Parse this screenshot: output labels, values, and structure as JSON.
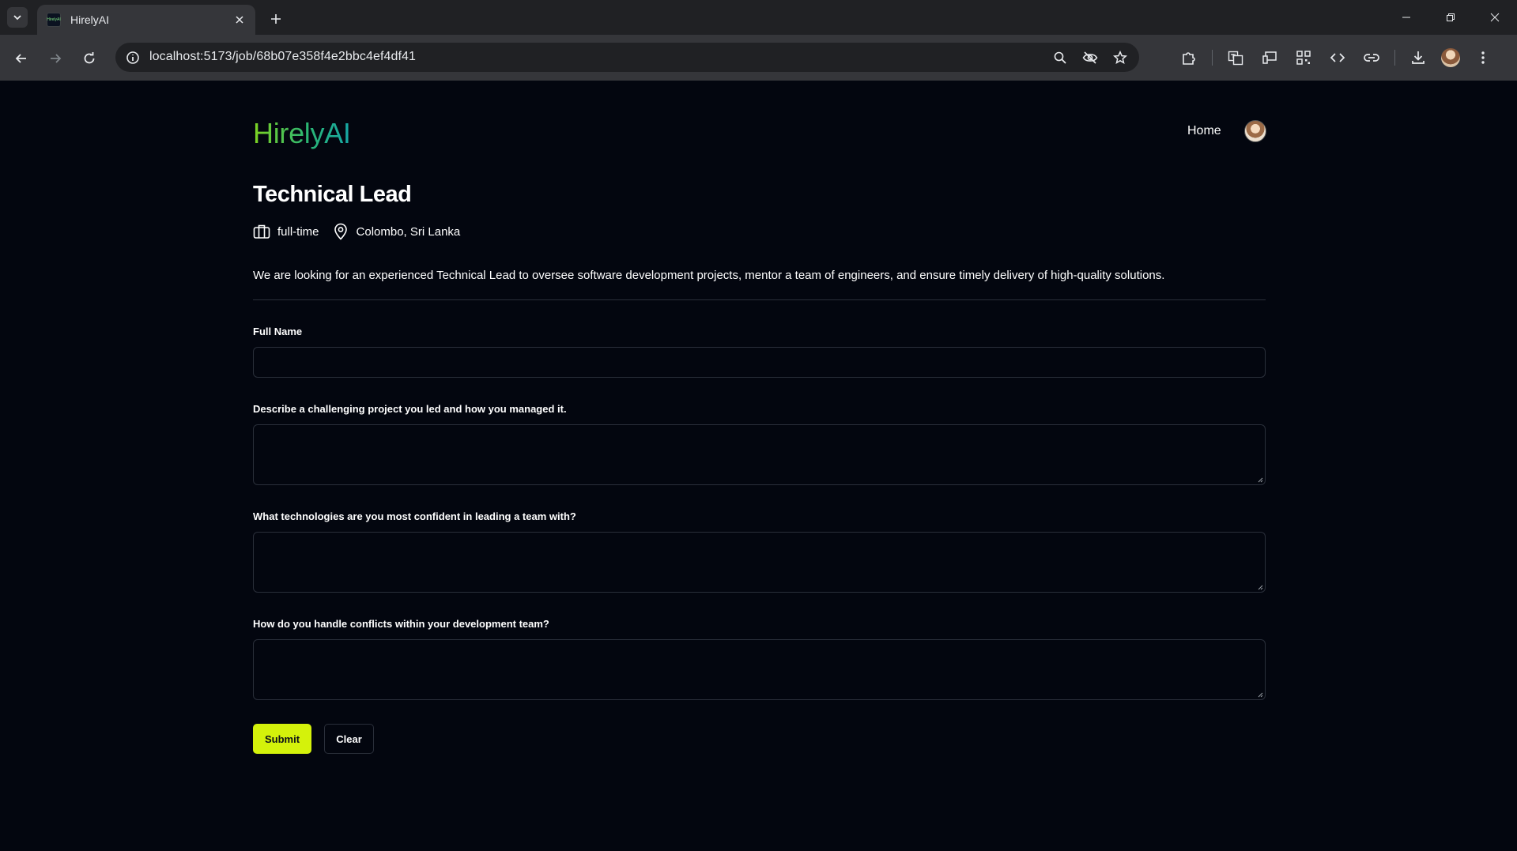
{
  "browser": {
    "tab": {
      "title": "HirelyAI",
      "favicon_text": "HirelyAI"
    },
    "url": "localhost:5173/job/68b07e358f4e2bbc4ef4df41",
    "icons": {
      "tab_list": "chevron-down-icon",
      "tab_close": "close-icon",
      "new_tab": "plus-icon",
      "back": "back-arrow-icon",
      "forward": "forward-arrow-icon",
      "reload": "reload-icon",
      "site_info": "info-icon",
      "zoom": "zoom-icon",
      "tracking": "eye-off-icon",
      "bookmark": "star-icon",
      "extensions": "puzzle-icon",
      "translate": "translate-icon",
      "cast": "cast-icon",
      "qr": "qr-code-icon",
      "devtools": "code-icon",
      "link": "link-icon",
      "download": "download-icon",
      "menu": "kebab-menu-icon"
    }
  },
  "header": {
    "logo": "HirelyAI",
    "nav_home": "Home"
  },
  "job": {
    "title": "Technical Lead",
    "type": "full-time",
    "location": "Colombo, Sri Lanka",
    "description": "We are looking for an experienced Technical Lead to oversee software development projects, mentor a team of engineers, and ensure timely delivery of high-quality solutions."
  },
  "form": {
    "full_name_label": "Full Name",
    "full_name_value": "",
    "questions": [
      {
        "label": "Describe a challenging project you led and how you managed it.",
        "value": ""
      },
      {
        "label": "What technologies are you most confident in leading a team with?",
        "value": ""
      },
      {
        "label": "How do you handle conflicts within your development team?",
        "value": ""
      }
    ],
    "submit_label": "Submit",
    "clear_label": "Clear"
  },
  "colors": {
    "background": "#03060f",
    "accent_button": "#d4f20b",
    "logo_gradient_start": "#7ed321",
    "logo_gradient_end": "#16a6a6"
  }
}
